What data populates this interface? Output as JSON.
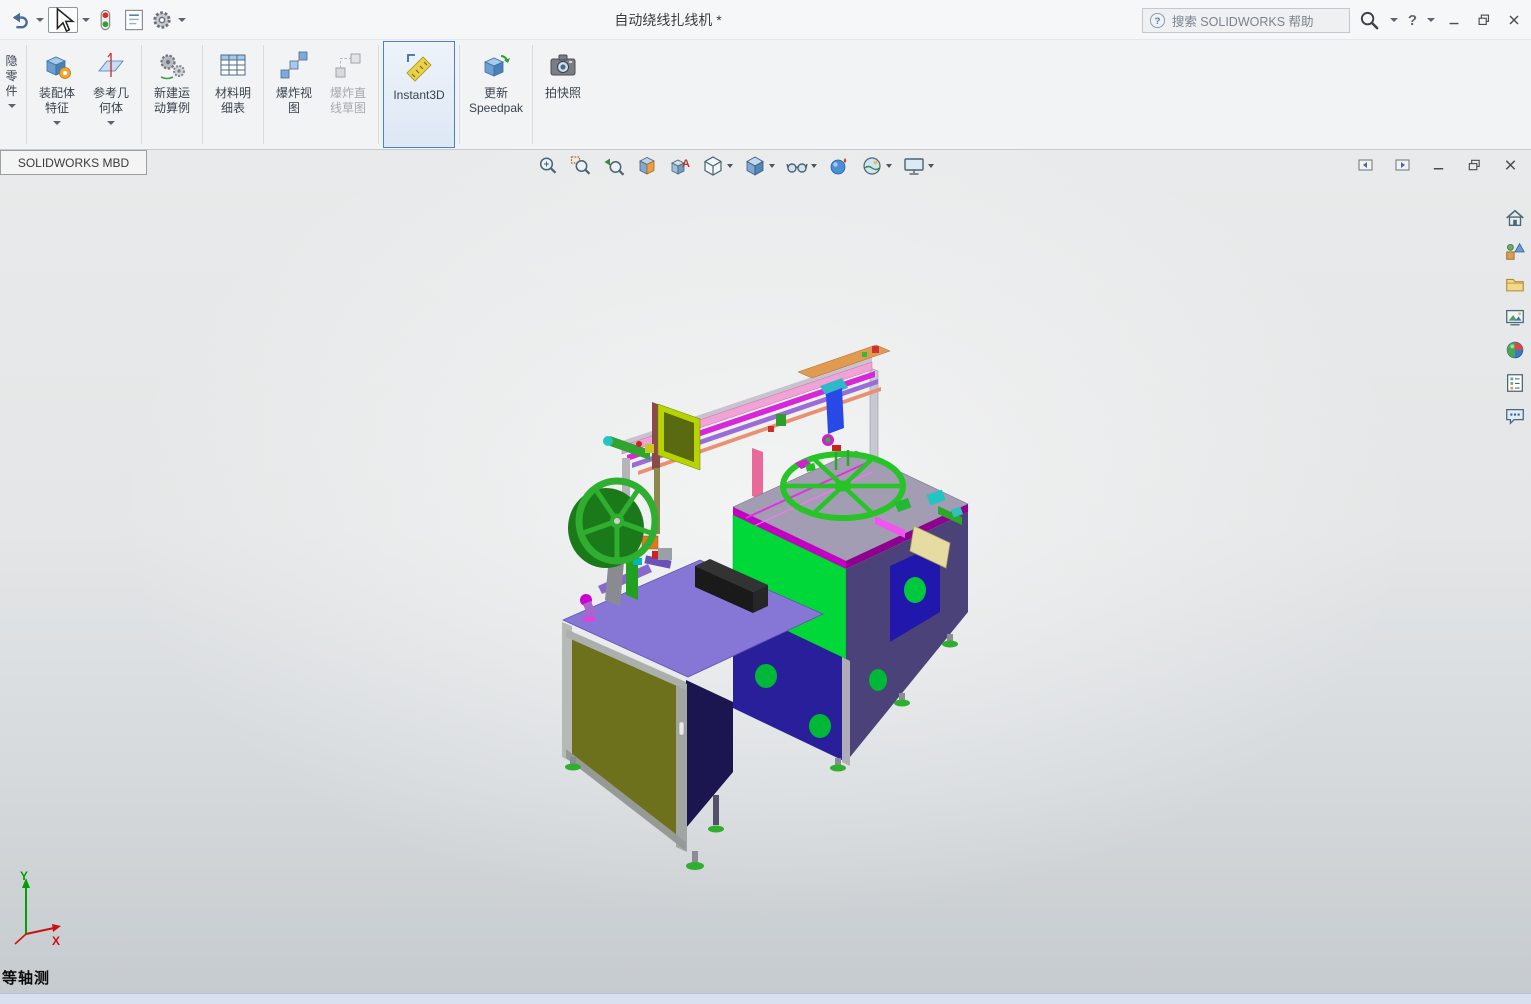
{
  "window": {
    "title": "自动绕线扎线机 *",
    "help_label": "?"
  },
  "quick_access": {
    "icons": [
      {
        "name": "undo"
      },
      {
        "name": "select-arrow"
      },
      {
        "name": "selection-filter"
      },
      {
        "name": "document-properties"
      },
      {
        "name": "options-gear"
      }
    ]
  },
  "search": {
    "placeholder": "搜索 SOLIDWORKS 帮助"
  },
  "ribbon": {
    "buttons": [
      {
        "name": "hide-components",
        "line1": "隐",
        "line2": "零",
        "line3": "件",
        "dropdown": true
      },
      {
        "name": "assembly-features",
        "line1": "装配体",
        "line2": "特征",
        "dropdown": true
      },
      {
        "name": "reference-geometry",
        "line1": "参考几",
        "line2": "何体",
        "dropdown": true
      },
      {
        "name": "new-motion-study",
        "line1": "新建运",
        "line2": "动算例",
        "dropdown": false
      },
      {
        "name": "bill-of-materials",
        "line1": "材料明",
        "line2": "细表",
        "dropdown": false
      },
      {
        "name": "exploded-view",
        "line1": "爆炸视",
        "line2": "图",
        "dropdown": false
      },
      {
        "name": "explode-line-sketch",
        "line1": "爆炸直",
        "line2": "线草图",
        "dropdown": false,
        "disabled": true
      },
      {
        "name": "instant3d",
        "line1": "Instant3D",
        "line2": "",
        "active": true
      },
      {
        "name": "update-speedpak",
        "line1": "更新",
        "line2": "Speedpak",
        "dropdown": false
      },
      {
        "name": "take-snapshot",
        "line1": "拍快照",
        "line2": "",
        "dropdown": false
      }
    ]
  },
  "mbd_tab": {
    "label": "SOLIDWORKS MBD"
  },
  "heads_up_toolbar": {
    "tools": [
      {
        "name": "zoom-to-fit"
      },
      {
        "name": "zoom-to-area"
      },
      {
        "name": "previous-view"
      },
      {
        "name": "section-view"
      },
      {
        "name": "annotation-views"
      },
      {
        "name": "view-orientation",
        "dropdown": true
      },
      {
        "name": "display-style",
        "dropdown": true
      },
      {
        "name": "hide-show-items",
        "dropdown": true
      },
      {
        "name": "edit-appearance"
      },
      {
        "name": "apply-scene",
        "dropdown": true
      },
      {
        "name": "view-settings",
        "dropdown": true
      }
    ]
  },
  "document_window_controls": [
    {
      "name": "previous-window"
    },
    {
      "name": "next-window"
    },
    {
      "name": "minimize-document"
    },
    {
      "name": "restore-document"
    },
    {
      "name": "close-document"
    }
  ],
  "task_pane": {
    "items": [
      {
        "name": "home"
      },
      {
        "name": "design-library"
      },
      {
        "name": "file-explorer"
      },
      {
        "name": "view-palette"
      },
      {
        "name": "appearances-scenes"
      },
      {
        "name": "custom-properties"
      },
      {
        "name": "solidworks-forums"
      }
    ]
  },
  "viewport": {
    "orientation_label": "等轴测",
    "triad": {
      "x_label": "X",
      "y_label": "Y"
    }
  },
  "colors": {
    "active_tool_border": "#4a82c3",
    "model_tabletop_purple": "#8677d6",
    "model_panel_olive": "#6e711c",
    "model_bright_green": "#00d83a",
    "model_magenta_trim": "#c400c4",
    "model_blue_panel": "#2217ac",
    "beam_pink": "#f2a3d6",
    "beam_orange": "#e09a52"
  }
}
